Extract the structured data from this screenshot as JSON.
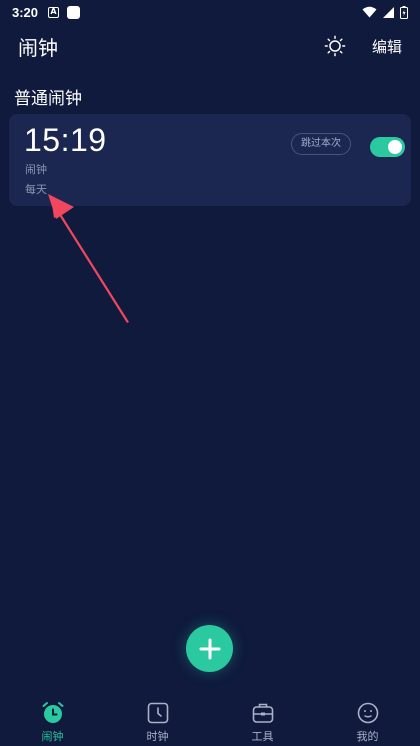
{
  "status_bar": {
    "time": "3:20",
    "notification_letter": "A"
  },
  "app_bar": {
    "title": "闹钟",
    "edit_label": "编辑",
    "theme_icon": "sun-icon"
  },
  "section": {
    "title": "普通闹钟"
  },
  "alarms": [
    {
      "time": "15:19",
      "label": "闹钟",
      "repeat": "每天",
      "skip_label": "跳过本次",
      "enabled": true
    }
  ],
  "fab": {
    "icon": "plus-icon"
  },
  "bottom_nav": {
    "items": [
      {
        "label": "闹钟",
        "icon": "alarm-clock-icon",
        "active": true
      },
      {
        "label": "时钟",
        "icon": "clock-icon",
        "active": false
      },
      {
        "label": "工具",
        "icon": "toolbox-icon",
        "active": false
      },
      {
        "label": "我的",
        "icon": "profile-face-icon",
        "active": false
      }
    ]
  },
  "colors": {
    "background": "#0f1a3d",
    "card": "#1b2750",
    "accent": "#2bc9a0",
    "annotation_arrow": "#f0475e"
  }
}
